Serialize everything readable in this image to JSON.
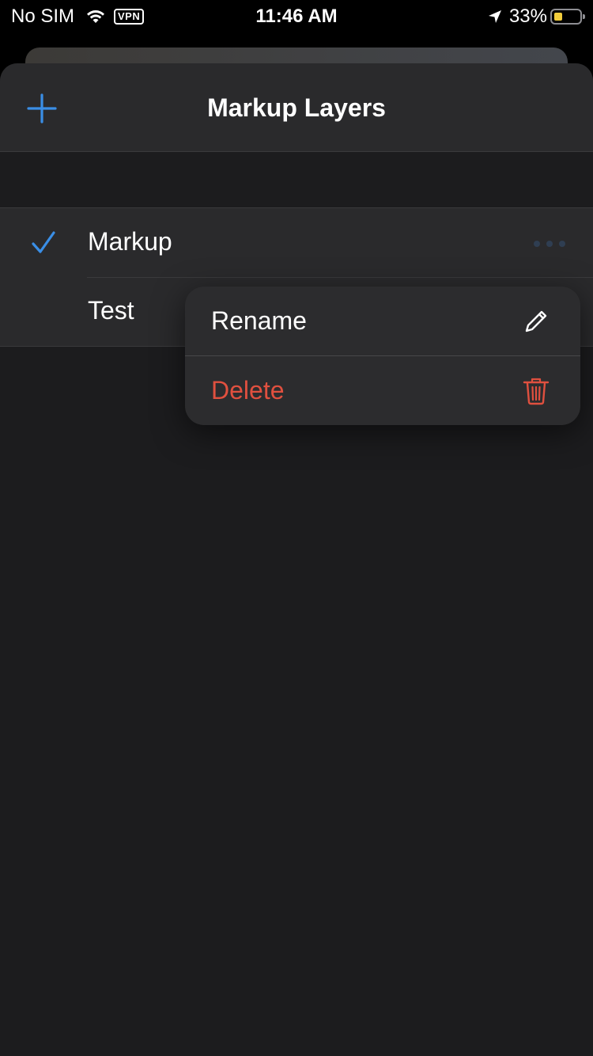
{
  "status_bar": {
    "carrier": "No SIM",
    "vpn": "VPN",
    "time": "11:46 AM",
    "battery_percent": "33%",
    "battery_level": 0.33
  },
  "sheet": {
    "title": "Markup Layers",
    "add_icon": "plus-icon"
  },
  "layers": [
    {
      "label": "Markup",
      "selected": true
    },
    {
      "label": "Test",
      "selected": false
    }
  ],
  "context_menu": {
    "items": [
      {
        "label": "Rename",
        "icon": "pencil-icon",
        "destructive": false
      },
      {
        "label": "Delete",
        "icon": "trash-icon",
        "destructive": true
      }
    ]
  },
  "colors": {
    "accent": "#3a8ee6",
    "destructive": "#e0503f",
    "background": "#1c1c1e",
    "row": "#2a2a2c"
  }
}
